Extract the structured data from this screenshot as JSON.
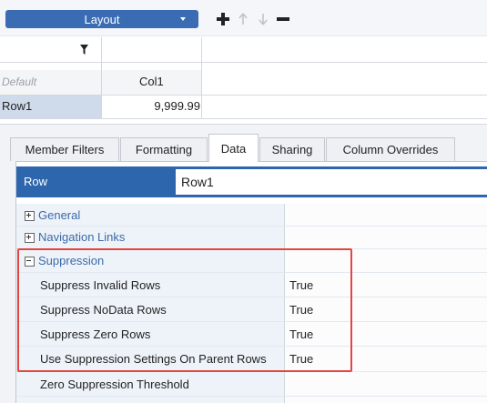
{
  "toolbar": {
    "layout_label": "Layout",
    "icons": [
      "plus-icon",
      "arrow-up-icon",
      "arrow-down-icon",
      "minus-icon"
    ]
  },
  "grid": {
    "filter_icon": "filter-icon",
    "corner_label": "Default",
    "column_header": "Col1",
    "row_label": "Row1",
    "cell_value": "9,999.99"
  },
  "tabs": [
    {
      "label": "Member Filters"
    },
    {
      "label": "Formatting"
    },
    {
      "label": "Data",
      "active": true
    },
    {
      "label": "Sharing"
    },
    {
      "label": "Column Overrides"
    }
  ],
  "row_header": {
    "key": "Row",
    "value": "Row1"
  },
  "groups": {
    "general": "General",
    "navigation_links": "Navigation Links",
    "suppression": "Suppression"
  },
  "suppression_props": [
    {
      "name": "Suppress Invalid Rows",
      "value": "True"
    },
    {
      "name": "Suppress NoData Rows",
      "value": "True"
    },
    {
      "name": "Suppress Zero Rows",
      "value": "True"
    },
    {
      "name": "Use Suppression Settings On Parent Rows",
      "value": "True"
    }
  ],
  "zero_threshold": {
    "name": "Zero Suppression Threshold",
    "value": ""
  },
  "colors": {
    "accent": "#3a6cb3",
    "header_blue": "#2e66ad",
    "highlight": "#e3463e"
  }
}
